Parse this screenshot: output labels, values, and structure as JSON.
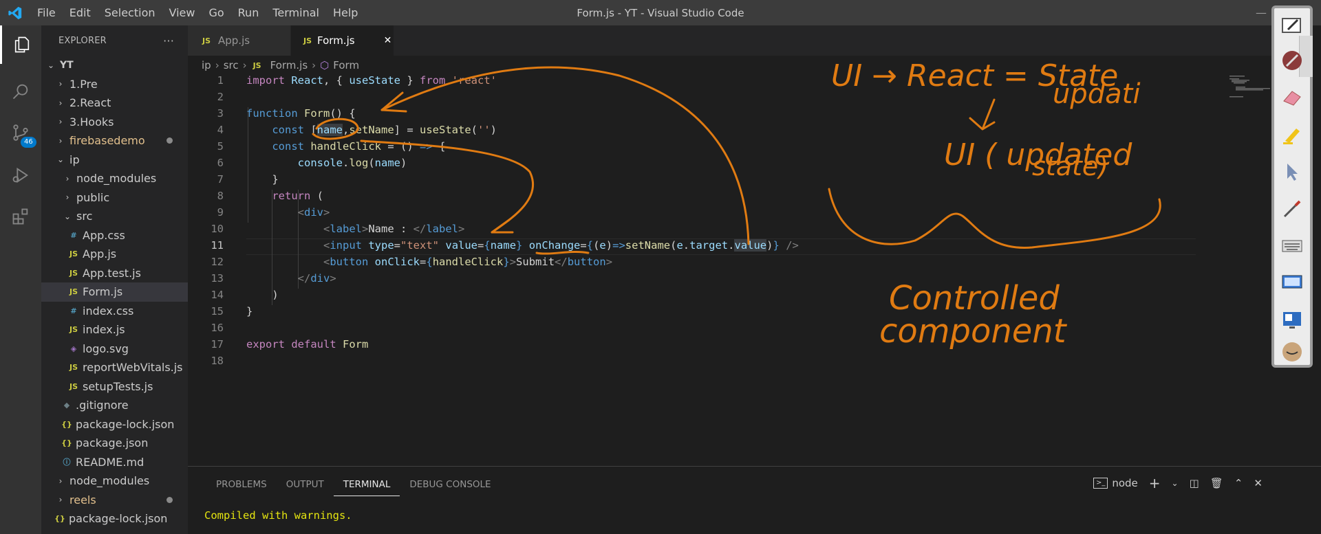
{
  "titlebar": {
    "menu": [
      "File",
      "Edit",
      "Selection",
      "View",
      "Go",
      "Run",
      "Terminal",
      "Help"
    ],
    "title": "Form.js - YT - Visual Studio Code"
  },
  "activity": {
    "scm_badge": "46"
  },
  "sidebar": {
    "header": "EXPLORER",
    "more": "···",
    "root": "YT",
    "items": [
      {
        "label": "1.Pre"
      },
      {
        "label": "2.React"
      },
      {
        "label": "3.Hooks"
      },
      {
        "label": "firebasedemo"
      },
      {
        "label": "ip"
      },
      {
        "label": "node_modules"
      },
      {
        "label": "public"
      },
      {
        "label": "src"
      },
      {
        "label": "App.css"
      },
      {
        "label": "App.js"
      },
      {
        "label": "App.test.js"
      },
      {
        "label": "Form.js"
      },
      {
        "label": "index.css"
      },
      {
        "label": "index.js"
      },
      {
        "label": "logo.svg"
      },
      {
        "label": "reportWebVitals.js"
      },
      {
        "label": "setupTests.js"
      },
      {
        "label": ".gitignore"
      },
      {
        "label": "package-lock.json"
      },
      {
        "label": "package.json"
      },
      {
        "label": "README.md"
      },
      {
        "label": "node_modules"
      },
      {
        "label": "reels"
      },
      {
        "label": "package-lock.json"
      }
    ]
  },
  "tabs": [
    {
      "label": "App.js"
    },
    {
      "label": "Form.js"
    }
  ],
  "breadcrumb": [
    "ip",
    "src",
    "Form.js",
    "Form"
  ],
  "code": {
    "line_numbers": [
      "1",
      "2",
      "3",
      "4",
      "5",
      "6",
      "7",
      "8",
      "9",
      "10",
      "11",
      "12",
      "13",
      "14",
      "15",
      "16",
      "17",
      "18"
    ]
  },
  "panel": {
    "tabs": [
      "PROBLEMS",
      "OUTPUT",
      "TERMINAL",
      "DEBUG CONSOLE"
    ],
    "terminal_name": "node",
    "terminal_output": "Compiled with warnings."
  },
  "annotations": {
    "line1": "UI → React = State",
    "line1b": "updati",
    "line2": "UI ( updated",
    "line2b": "state)",
    "line3": "Controlled",
    "line3b": "component"
  },
  "colors": {
    "ink": "#e07b12",
    "accent": "#007acc"
  }
}
